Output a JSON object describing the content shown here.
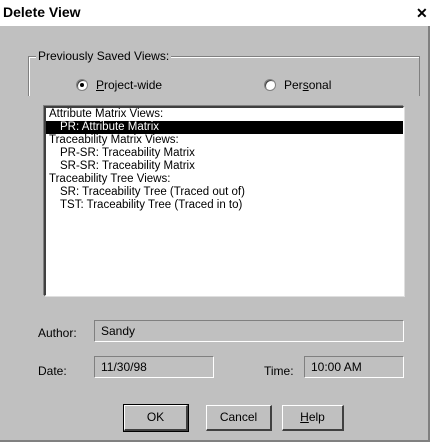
{
  "window": {
    "title": "Delete View",
    "close_glyph": "✕"
  },
  "group": {
    "label": "Previously Saved Views:",
    "options": [
      {
        "key": "P",
        "rest": "roject-wide",
        "checked": true
      },
      {
        "key": "Per",
        "rest_u": "s",
        "rest": "onal",
        "checked": false
      }
    ]
  },
  "list": {
    "items": [
      {
        "text": "Attribute Matrix Views:",
        "kind": "header",
        "selected": false
      },
      {
        "text": "PR: Attribute Matrix",
        "kind": "child",
        "selected": true
      },
      {
        "text": "Traceability Matrix Views:",
        "kind": "header",
        "selected": false
      },
      {
        "text": "PR-SR: Traceability Matrix",
        "kind": "child",
        "selected": false
      },
      {
        "text": "SR-SR: Traceability Matrix",
        "kind": "child",
        "selected": false
      },
      {
        "text": "Traceability Tree Views:",
        "kind": "header",
        "selected": false
      },
      {
        "text": "SR: Traceability Tree (Traced out of)",
        "kind": "child",
        "selected": false
      },
      {
        "text": "TST: Traceability Tree (Traced in to)",
        "kind": "child",
        "selected": false
      }
    ]
  },
  "fields": {
    "author_label": "Author:",
    "author_value": "Sandy",
    "date_label": "Date:",
    "date_value": "11/30/98",
    "time_label": "Time:",
    "time_value": "10:00 AM"
  },
  "buttons": {
    "ok": "OK",
    "cancel": "Cancel",
    "help_key": "H",
    "help_rest": "elp"
  }
}
